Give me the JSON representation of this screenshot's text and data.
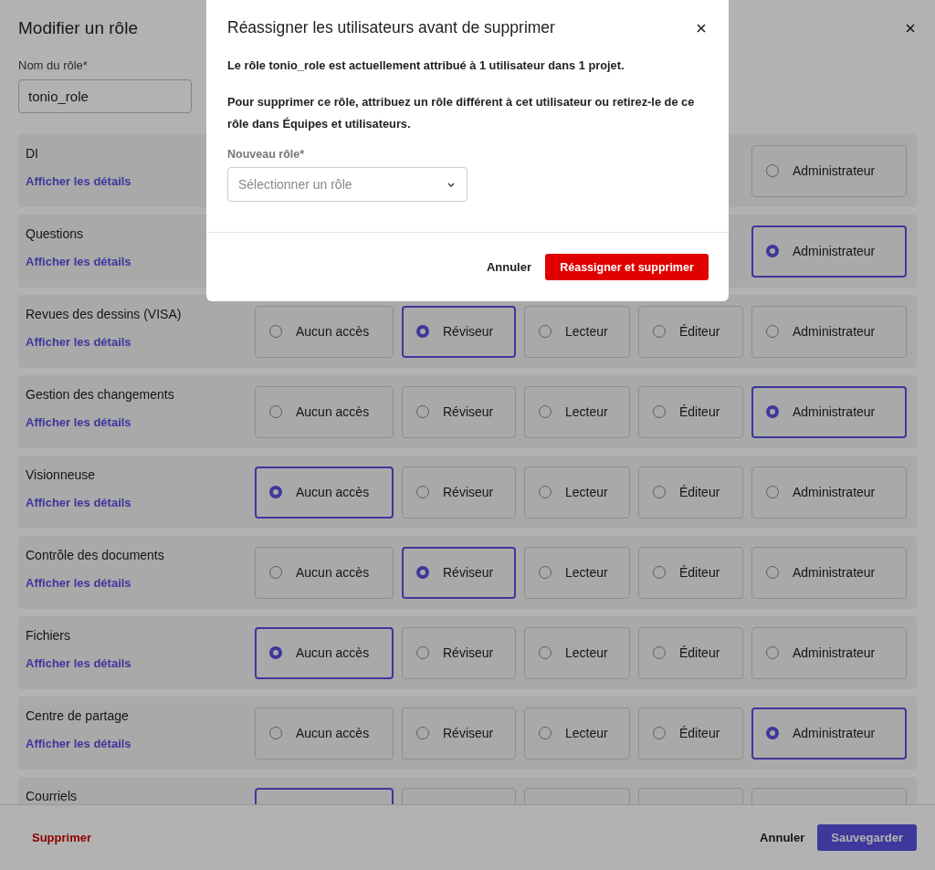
{
  "page": {
    "title": "Modifier un rôle",
    "name_label": "Nom du rôle*",
    "name_value": "tonio_role"
  },
  "permissions": [
    {
      "name": "DI",
      "link": "Afficher les détails",
      "options": [
        {
          "label": "Administrateur",
          "selected": false
        }
      ]
    },
    {
      "name": "Questions",
      "link": "Afficher les détails",
      "options": [
        {
          "label": "Administrateur",
          "selected": true
        }
      ]
    },
    {
      "name": "Revues des dessins (VISA)",
      "link": "Afficher les détails",
      "options": [
        {
          "label": "Aucun accès",
          "selected": false
        },
        {
          "label": "Réviseur",
          "selected": true
        },
        {
          "label": "Lecteur",
          "selected": false
        },
        {
          "label": "Éditeur",
          "selected": false
        },
        {
          "label": "Administrateur",
          "selected": false
        }
      ]
    },
    {
      "name": "Gestion des changements",
      "link": "Afficher les détails",
      "options": [
        {
          "label": "Aucun accès",
          "selected": false
        },
        {
          "label": "Réviseur",
          "selected": false
        },
        {
          "label": "Lecteur",
          "selected": false
        },
        {
          "label": "Éditeur",
          "selected": false
        },
        {
          "label": "Administrateur",
          "selected": true
        }
      ]
    },
    {
      "name": "Visionneuse",
      "link": "Afficher les détails",
      "options": [
        {
          "label": "Aucun accès",
          "selected": true
        },
        {
          "label": "Réviseur",
          "selected": false
        },
        {
          "label": "Lecteur",
          "selected": false
        },
        {
          "label": "Éditeur",
          "selected": false
        },
        {
          "label": "Administrateur",
          "selected": false
        }
      ]
    },
    {
      "name": "Contrôle des documents",
      "link": "Afficher les détails",
      "options": [
        {
          "label": "Aucun accès",
          "selected": false
        },
        {
          "label": "Réviseur",
          "selected": true
        },
        {
          "label": "Lecteur",
          "selected": false
        },
        {
          "label": "Éditeur",
          "selected": false
        },
        {
          "label": "Administrateur",
          "selected": false
        }
      ]
    },
    {
      "name": "Fichiers",
      "link": "Afficher les détails",
      "options": [
        {
          "label": "Aucun accès",
          "selected": true
        },
        {
          "label": "Réviseur",
          "selected": false
        },
        {
          "label": "Lecteur",
          "selected": false
        },
        {
          "label": "Éditeur",
          "selected": false
        },
        {
          "label": "Administrateur",
          "selected": false
        }
      ]
    },
    {
      "name": "Centre de partage",
      "link": "Afficher les détails",
      "options": [
        {
          "label": "Aucun accès",
          "selected": false
        },
        {
          "label": "Réviseur",
          "selected": false
        },
        {
          "label": "Lecteur",
          "selected": false
        },
        {
          "label": "Éditeur",
          "selected": false
        },
        {
          "label": "Administrateur",
          "selected": true
        }
      ]
    },
    {
      "name": "Courriels",
      "options": [
        {
          "selected": true
        },
        {
          "selected": false
        },
        {
          "selected": false
        },
        {
          "selected": false
        },
        {
          "selected": false
        }
      ]
    }
  ],
  "footer": {
    "delete": "Supprimer",
    "cancel": "Annuler",
    "save": "Sauvegarder"
  },
  "dialog": {
    "title": "Réassigner les utilisateurs avant de supprimer",
    "paragraphs": [
      "Le rôle tonio_role est actuellement attribué à 1 utilisateur dans 1 projet.",
      "Pour supprimer ce rôle, attribuez un rôle différent à cet utilisateur ou retirez-le de ce rôle dans Équipes et utilisateurs."
    ],
    "field_label": "Nouveau rôle*",
    "placeholder": "Sélectionner un rôle",
    "cancel": "Annuler",
    "confirm": "Réassigner et supprimer"
  }
}
